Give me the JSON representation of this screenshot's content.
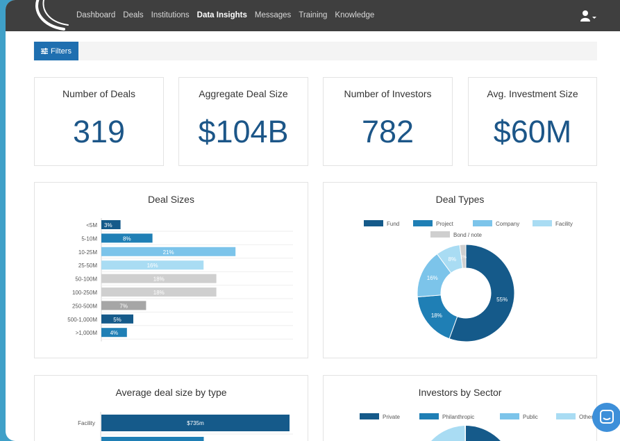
{
  "nav": {
    "items": [
      "Dashboard",
      "Deals",
      "Institutions",
      "Data Insights",
      "Messages",
      "Training",
      "Knowledge"
    ],
    "active": "Data Insights"
  },
  "filters": {
    "label": "Filters"
  },
  "kpis": [
    {
      "title": "Number of Deals",
      "value": "319"
    },
    {
      "title": "Aggregate Deal Size",
      "value": "$104B"
    },
    {
      "title": "Number of Investors",
      "value": "782"
    },
    {
      "title": "Avg. Investment Size",
      "value": "$60M"
    }
  ],
  "colors": {
    "dark_blue": "#155a8a",
    "mid_blue": "#1f7fb5",
    "light_blue": "#7cc4ea",
    "pale_blue": "#a9dcf3",
    "light_gray": "#cfcfcf",
    "gray": "#a6a6a6",
    "text_blue": "#1c5688"
  },
  "chart_data": [
    {
      "type": "bar",
      "title": "Deal Sizes",
      "categories": [
        "<5M",
        "5-10M",
        "10-25M",
        "25-50M",
        "50-100M",
        "100-250M",
        "250-500M",
        "500-1,000M",
        ">1,000M"
      ],
      "values": [
        3,
        8,
        21,
        16,
        18,
        18,
        7,
        5,
        4
      ],
      "value_labels": [
        "3%",
        "8%",
        "21%",
        "16%",
        "18%",
        "18%",
        "7%",
        "5%",
        "4%"
      ],
      "colors": [
        "#155a8a",
        "#1f7fb5",
        "#7cc4ea",
        "#a9dcf3",
        "#cfcfcf",
        "#cfcfcf",
        "#a6a6a6",
        "#155a8a",
        "#1f7fb5"
      ],
      "orientation": "horizontal",
      "xlim": [
        0,
        25
      ]
    },
    {
      "type": "pie",
      "title": "Deal Types",
      "legend": [
        "Fund",
        "Project",
        "Company",
        "Facility",
        "Bond / note"
      ],
      "legend_position": "top",
      "values": [
        55,
        18,
        16,
        8,
        2
      ],
      "value_labels": [
        "55%",
        "18%",
        "16%",
        "8%",
        "2%"
      ],
      "colors": [
        "#155a8a",
        "#1f7fb5",
        "#7cc4ea",
        "#a9dcf3",
        "#cfcfcf"
      ]
    },
    {
      "type": "bar",
      "title": "Average deal size by type",
      "categories": [
        "Facility",
        ""
      ],
      "values": [
        735,
        400
      ],
      "value_labels": [
        "$735m",
        ""
      ],
      "orientation": "horizontal",
      "xlim": [
        0,
        800
      ]
    },
    {
      "type": "pie",
      "title": "Investors by Sector",
      "legend": [
        "Private",
        "Philanthropic",
        "Public",
        "Other"
      ],
      "legend_position": "top",
      "colors": [
        "#155a8a",
        "#1f7fb5",
        "#7cc4ea",
        "#a9dcf3"
      ]
    }
  ]
}
